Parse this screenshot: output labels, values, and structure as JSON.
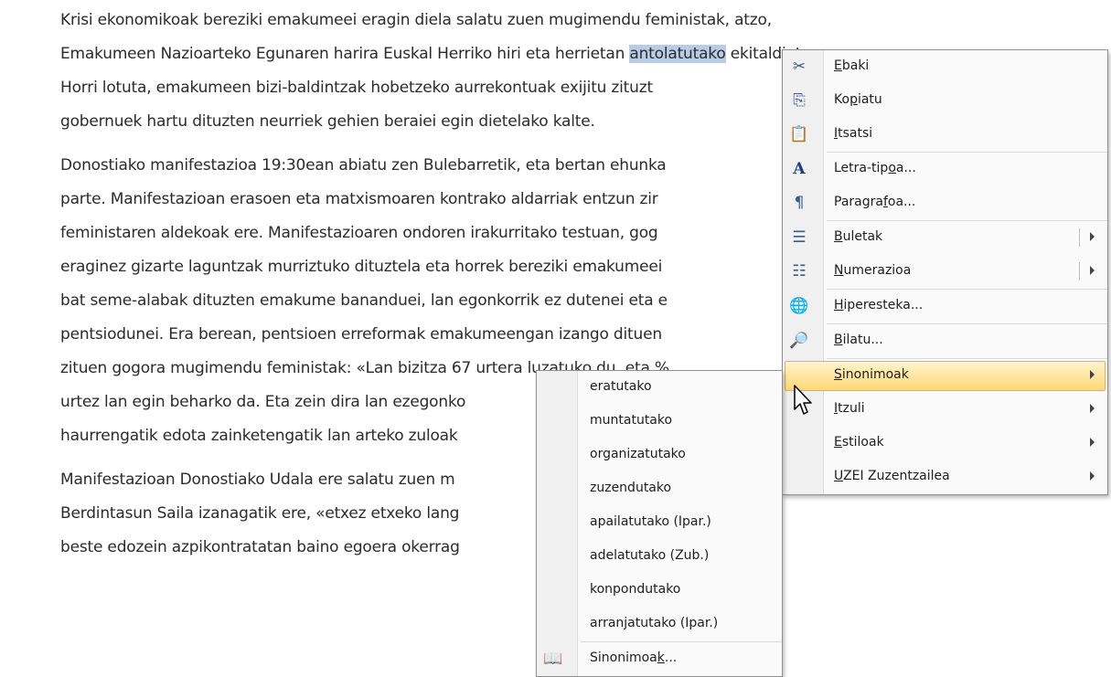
{
  "document": {
    "paragraphs": [
      {
        "lines": [
          {
            "text": "Krisi ekonomikoak bereziki emakumeei eragin diela salatu zuen mugimendu feministak, atzo,"
          },
          {
            "pre": "Emakumeen Nazioarteko Egunaren harira Euskal Herriko hiri eta herrietan ",
            "highlight": "antolatutako",
            "post": " ekitaldietan."
          },
          {
            "text": "Horri lotuta, emakumeen bizi-baldintzak hobetzeko aurrekontuak exijitu zituzt"
          },
          {
            "text": "gobernuek hartu dituzten neurriek gehien beraiei egin dietelako kalte."
          }
        ]
      },
      {
        "lines": [
          {
            "text": "Donostiako manifestazioa 19:30ean abiatu zen Bulebarretik, eta bertan ehunka"
          },
          {
            "text": "parte. Manifestazioan erasoen eta matxismoaren kontrako aldarriak entzun zir"
          },
          {
            "text": "feministaren aldekoak ere. Manifestazioaren ondoren irakurritako testuan, gog"
          },
          {
            "text": "eraginez gizarte laguntzak murriztuko dituztela eta horrek bereziki emakumeei"
          },
          {
            "text": "bat seme-alabak dituzten emakume bananduei, lan egonkorrik ez dutenei eta e"
          },
          {
            "text": "pentsiodunei. Era berean, pentsioen erreformak emakumeengan izango dituen"
          },
          {
            "text": "zituen gogora mugimendu feministak: «Lan bizitza 67 urtera luzatuko du, eta %"
          },
          {
            "text": "urtez lan egin beharko da. Eta zein dira lan ezegonko"
          },
          {
            "text": "haurrengatik edota zainketengatik lan arteko zuloak"
          }
        ]
      },
      {
        "lines": [
          {
            "text": "Manifestazioan Donostiako Udala ere salatu zuen m"
          },
          {
            "text": "Berdintasun Saila izanagatik ere, «etxez etxeko lang"
          },
          {
            "text": "beste edozein azpikontratatan baino egoera okerrag"
          }
        ]
      }
    ]
  },
  "context_menu": {
    "items": [
      {
        "pre": "",
        "u": "E",
        "post": "baki",
        "icon": "scissors-icon",
        "glyph": "✂"
      },
      {
        "pre": "Ko",
        "u": "p",
        "post": "iatu",
        "icon": "copy-icon",
        "glyph": "⎘"
      },
      {
        "pre": "",
        "u": "I",
        "post": "tsatsi",
        "icon": "paste-icon",
        "glyph": "📋"
      },
      {
        "pre": "Letra-tip",
        "u": "o",
        "post": "a...",
        "icon": "font-icon",
        "glyph": "A"
      },
      {
        "pre": "Paragra",
        "u": "f",
        "post": "oa...",
        "icon": "paragraph-icon",
        "glyph": "¶"
      },
      {
        "pre": "",
        "u": "B",
        "post": "uletak",
        "icon": "bullets-icon",
        "glyph": "☰"
      },
      {
        "pre": "",
        "u": "N",
        "post": "umerazioa",
        "icon": "numbering-icon",
        "glyph": "☷"
      },
      {
        "pre": "",
        "u": "H",
        "post": "iperesteka...",
        "icon": "hyperlink-icon",
        "glyph": "🌐"
      },
      {
        "pre": "",
        "u": "B",
        "post": "ilatu...",
        "icon": "lookup-icon",
        "glyph": "🔎"
      },
      {
        "pre": "",
        "u": "S",
        "post": "inonimoak",
        "icon": "",
        "glyph": ""
      },
      {
        "pre": "",
        "u": "I",
        "post": "tzuli",
        "icon": "",
        "glyph": ""
      },
      {
        "pre": "",
        "u": "E",
        "post": "stiloak",
        "icon": "",
        "glyph": ""
      },
      {
        "pre": "",
        "u": "U",
        "post": "ZEI Zuzentzailea",
        "icon": "",
        "glyph": ""
      }
    ]
  },
  "synonyms_menu": {
    "items": [
      "eratutako",
      "muntatutako",
      "organizatutako",
      "zuzendutako",
      "apailatutako (Ipar.)",
      "adelatutako (Zub.)",
      "konpondutako",
      "arranjatutako (Ipar.)"
    ],
    "thesaurus": {
      "pre": "Sinonimoa",
      "u": "k",
      "post": "...",
      "icon": "thesaurus-icon",
      "glyph": "📖"
    }
  },
  "colors": {
    "selection": "#b9cce6",
    "menu_hover": "#ffd779",
    "menu_border": "#8f8f8f"
  }
}
